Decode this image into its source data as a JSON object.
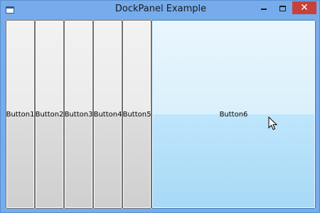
{
  "window": {
    "title": "DockPanel Example",
    "controls": {
      "minimize_icon": "minimize-icon",
      "maximize_icon": "maximize-icon",
      "close_icon": "close-icon",
      "close_glyph": "✕"
    },
    "accent_color": "#76acec",
    "close_color": "#c7413a"
  },
  "dock_panel": {
    "buttons": [
      {
        "label": "Button1"
      },
      {
        "label": "Button2"
      },
      {
        "label": "Button3"
      },
      {
        "label": "Button4"
      },
      {
        "label": "Button5"
      },
      {
        "label": "Button6",
        "state": "hover"
      }
    ]
  },
  "cursor": {
    "icon": "mouse-pointer-icon"
  }
}
